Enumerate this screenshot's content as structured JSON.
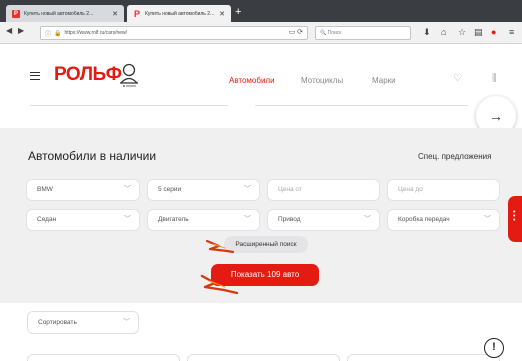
{
  "browser": {
    "tabs": [
      {
        "title": "Купить новый автомобиль 2...",
        "close": "✕"
      },
      {
        "title": "Купить новый автомобиль 2...",
        "close": "✕"
      }
    ],
    "new_tab": "+",
    "url": "https://www.rolf.ru/cars/new/",
    "search_placeholder": "Поиск"
  },
  "header": {
    "logo": "РОЛЬФ",
    "nav": [
      {
        "label": "Автомобили",
        "active": true
      },
      {
        "label": "Мотоциклы",
        "active": false
      },
      {
        "label": "Марки",
        "active": false
      }
    ],
    "next_arrow": "→"
  },
  "filters": {
    "title": "Автомобили в наличии",
    "special_offers": "Спец. предложения",
    "row1": [
      {
        "value": "BMW",
        "type": "select"
      },
      {
        "value": "5 серии",
        "type": "select"
      },
      {
        "placeholder": "Цена от",
        "type": "input"
      },
      {
        "placeholder": "Цена до",
        "type": "input"
      }
    ],
    "row2": [
      {
        "value": "Седан",
        "type": "select"
      },
      {
        "value": "Двигатель",
        "type": "select"
      },
      {
        "value": "Привод",
        "type": "select"
      },
      {
        "value": "Коробка передач",
        "type": "select"
      }
    ],
    "advanced_search": "Расширенный поиск",
    "show_button": "Показать 109 авто"
  },
  "sorting": {
    "label": "Сортировать"
  },
  "info_icon": "!",
  "colors": {
    "brand_red": "#e41b13",
    "filter_bg": "#f0f0f1"
  }
}
